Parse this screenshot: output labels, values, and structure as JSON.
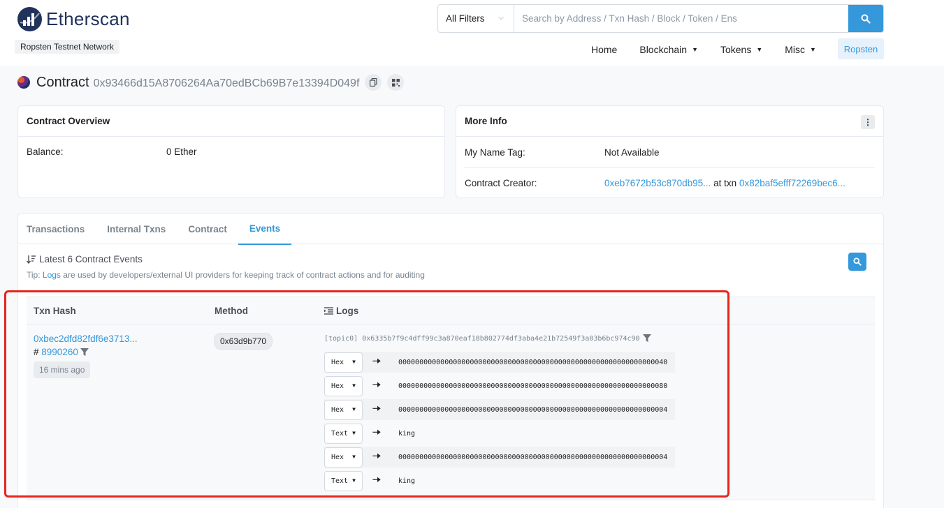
{
  "brand": {
    "name": "Etherscan",
    "network": "Ropsten Testnet Network"
  },
  "search": {
    "filter": "All Filters",
    "placeholder": "Search by Address / Txn Hash / Block / Token / Ens"
  },
  "nav": {
    "items": [
      "Home",
      "Blockchain",
      "Tokens",
      "Misc"
    ],
    "network_button": "Ropsten"
  },
  "contract": {
    "label": "Contract",
    "address": "0x93466d15A8706264Aa70edBCb69B7e13394D049f"
  },
  "overview": {
    "title": "Contract Overview",
    "balance_label": "Balance:",
    "balance_value": "0 Ether"
  },
  "more_info": {
    "title": "More Info",
    "name_tag_label": "My Name Tag:",
    "name_tag_value": "Not Available",
    "creator_label": "Contract Creator:",
    "creator_address": "0xeb7672b53c870db95...",
    "at_txn": "at txn",
    "creator_txn": "0x82baf5efff72269bec6..."
  },
  "tabs": [
    "Transactions",
    "Internal Txns",
    "Contract",
    "Events"
  ],
  "events": {
    "header": "Latest 6 Contract Events",
    "tip_prefix": "Tip:",
    "tip_link": "Logs",
    "tip_suffix": "are used by developers/external UI providers for keeping track of contract actions and for auditing",
    "columns": {
      "hash": "Txn Hash",
      "method": "Method",
      "logs": "Logs"
    },
    "row": {
      "hash": "0xbec2dfd82fdf6e3713...",
      "block_prefix": "#",
      "block": "8990260",
      "age": "16 mins ago",
      "method": "0x63d9b770",
      "topic_label": "[topic0]",
      "topic_value": "0x6335b7f9c4dff99c3a870eaf18b802774df3aba4e21b72549f3a03b6bc974c90",
      "logs": [
        {
          "decode": "Hex",
          "value": "0000000000000000000000000000000000000000000000000000000000000040"
        },
        {
          "decode": "Hex",
          "value": "0000000000000000000000000000000000000000000000000000000000000080"
        },
        {
          "decode": "Hex",
          "value": "0000000000000000000000000000000000000000000000000000000000000004"
        },
        {
          "decode": "Text",
          "value": "king"
        },
        {
          "decode": "Hex",
          "value": "0000000000000000000000000000000000000000000000000000000000000004"
        },
        {
          "decode": "Text",
          "value": "king"
        }
      ]
    }
  }
}
